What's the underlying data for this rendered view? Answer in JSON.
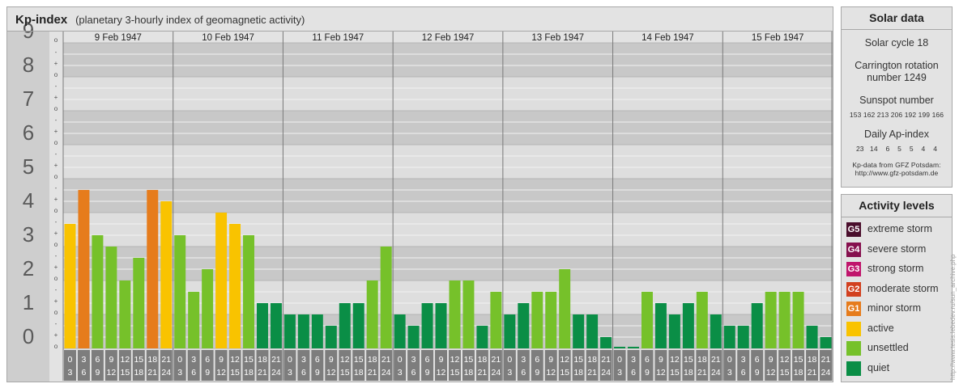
{
  "header": {
    "title": "Kp-index",
    "subtitle": "(planetary 3-hourly index of geomagnetic activity)"
  },
  "chart_data": {
    "type": "bar",
    "title": "Kp-index",
    "subtitle": "(planetary 3-hourly index of geomagnetic activity)",
    "ylim": [
      0,
      9
    ],
    "y_ticks": [
      "0",
      "1",
      "2",
      "3",
      "4",
      "5",
      "6",
      "7",
      "8",
      "9"
    ],
    "y_minor_ticks": [
      "+",
      "-",
      "o"
    ],
    "days": [
      "9 Feb 1947",
      "10 Feb 1947",
      "11 Feb 1947",
      "12 Feb 1947",
      "13 Feb 1947",
      "14 Feb 1947",
      "15 Feb 1947"
    ],
    "interval_start_hours": [
      "0",
      "3",
      "6",
      "9",
      "12",
      "15",
      "18",
      "21"
    ],
    "interval_end_hours": [
      "3",
      "6",
      "9",
      "12",
      "15",
      "18",
      "21",
      "24"
    ],
    "values": [
      [
        3.667,
        4.667,
        3.333,
        3.0,
        2.0,
        2.667,
        4.667,
        4.333
      ],
      [
        3.333,
        1.667,
        2.333,
        4.0,
        3.667,
        3.333,
        1.333,
        1.333
      ],
      [
        1.0,
        1.0,
        1.0,
        0.667,
        1.333,
        1.333,
        2.0,
        3.0
      ],
      [
        1.0,
        0.667,
        1.333,
        1.333,
        2.0,
        2.0,
        0.667,
        1.667
      ],
      [
        1.0,
        1.333,
        1.667,
        1.667,
        2.333,
        1.0,
        1.0,
        0.333
      ],
      [
        0.0,
        0.0,
        1.667,
        1.333,
        1.0,
        1.333,
        1.667,
        1.0
      ],
      [
        0.667,
        0.667,
        1.333,
        1.667,
        1.667,
        1.667,
        0.667,
        0.333
      ]
    ],
    "level_colors": {
      "quiet": "#0a8e46",
      "unsettled": "#76c12a",
      "active": "#f9c300",
      "minor_storm": "#e67c1c"
    },
    "grid": true
  },
  "solar": {
    "title": "Solar data",
    "cycle_label": "Solar cycle 18",
    "carrington_line1": "Carrington rotation",
    "carrington_line2": "number 1249",
    "sunspot_label": "Sunspot number",
    "sunspot_values": "153 162 213 206 192 199 166",
    "ap_label": "Daily Ap-index",
    "ap_values": "23   14    6    5    5    4    4",
    "source_line1": "Kp-data from GFZ Potsdam:",
    "source_line2": "http://www.gfz-potsdam.de"
  },
  "activity": {
    "title": "Activity levels",
    "levels": [
      {
        "code": "G5",
        "label": "extreme storm",
        "color": "#4a0e2c"
      },
      {
        "code": "G4",
        "label": "severe storm",
        "color": "#86104e"
      },
      {
        "code": "G3",
        "label": "strong storm",
        "color": "#c0156c"
      },
      {
        "code": "G2",
        "label": "moderate storm",
        "color": "#d2401f"
      },
      {
        "code": "G1",
        "label": "minor storm",
        "color": "#e67c1c"
      },
      {
        "code": "",
        "label": "active",
        "color": "#f9c300"
      },
      {
        "code": "",
        "label": "unsettled",
        "color": "#76c12a"
      },
      {
        "code": "",
        "label": "quiet",
        "color": "#0a8e46"
      }
    ]
  },
  "watermark": "http://www.tesis.lebedev.ru/sun_archive.php"
}
